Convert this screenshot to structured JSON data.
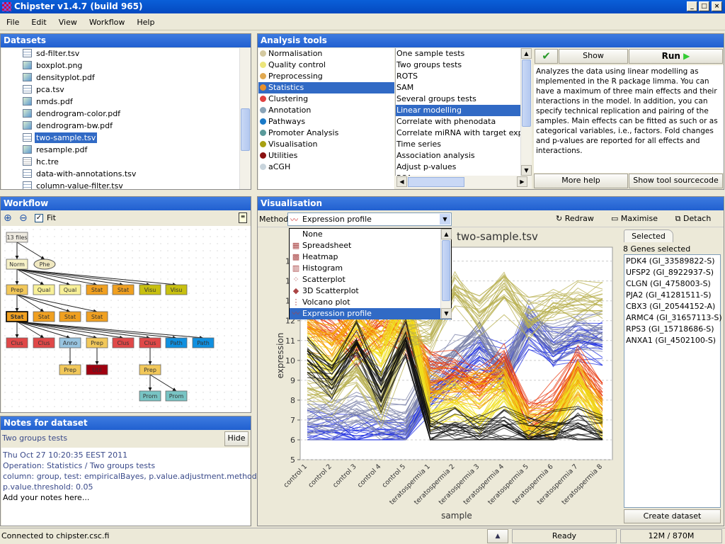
{
  "window": {
    "title": "Chipster v1.4.7 (build 965)",
    "controls": [
      "_",
      "□",
      "×"
    ]
  },
  "menu": [
    "File",
    "Edit",
    "View",
    "Workflow",
    "Help"
  ],
  "datasets": {
    "title": "Datasets",
    "items": [
      {
        "name": "sd-filter.tsv",
        "icon": "table"
      },
      {
        "name": "boxplot.png",
        "icon": "image"
      },
      {
        "name": "densityplot.pdf",
        "icon": "image"
      },
      {
        "name": "pca.tsv",
        "icon": "table"
      },
      {
        "name": "nmds.pdf",
        "icon": "image"
      },
      {
        "name": "dendrogram-color.pdf",
        "icon": "image"
      },
      {
        "name": "dendrogram-bw.pdf",
        "icon": "image"
      },
      {
        "name": "two-sample.tsv",
        "icon": "table",
        "selected": true
      },
      {
        "name": "resample.pdf",
        "icon": "image"
      },
      {
        "name": "hc.tre",
        "icon": "text"
      },
      {
        "name": "data-with-annotations.tsv",
        "icon": "table"
      },
      {
        "name": "column-value-filter.tsv",
        "icon": "table"
      }
    ]
  },
  "analysis": {
    "title": "Analysis tools",
    "categories": [
      {
        "label": "Normalisation",
        "color": "#d4c9a0"
      },
      {
        "label": "Quality control",
        "color": "#ece57a"
      },
      {
        "label": "Preprocessing",
        "color": "#e0a850"
      },
      {
        "label": "Statistics",
        "color": "#e8902c",
        "selected": true
      },
      {
        "label": "Clustering",
        "color": "#e04040"
      },
      {
        "label": "Annotation",
        "color": "#8aa4b8"
      },
      {
        "label": "Pathways",
        "color": "#1a7ac8"
      },
      {
        "label": "Promoter Analysis",
        "color": "#5a9a9a"
      },
      {
        "label": "Visualisation",
        "color": "#a8a010"
      },
      {
        "label": "Utilities",
        "color": "#8a1010"
      },
      {
        "label": "aCGH",
        "color": "#c8d4dc"
      }
    ],
    "tools": [
      "One sample tests",
      "Two groups tests",
      "ROTS",
      "SAM",
      "Several groups tests",
      "Linear modelling",
      "Correlate with phenodata",
      "Correlate miRNA with target express",
      "Time series",
      "Association analysis",
      "Adjust p-values",
      "PCA"
    ],
    "selected_tool": "Linear modelling",
    "show_parameters": "Show parameters",
    "run": "Run",
    "description": "Analyzes the data using linear modelling as implemented in the R package limma. You can have a maximum of three main effects and their interactions in the model. In addition, you can specify technical replication and pairing of the samples. Main effects can be fitted as such or as categorical variables, i.e., factors. Fold changes and p-values are reported for all effects and interactions.",
    "more_help": "More help",
    "show_source": "Show tool sourcecode"
  },
  "workflow": {
    "title": "Workflow",
    "fit_label": "Fit",
    "fit_checked": true,
    "nodes": [
      "13 files",
      "Norm",
      "Phe",
      "Prep",
      "Qual",
      "Qual",
      "Stat",
      "Stat",
      "Visu",
      "Visu",
      "Stat",
      "Stat",
      "Stat",
      "Stat",
      "Clus",
      "Clus",
      "Anno",
      "Prep",
      "Clus",
      "Clus",
      "Path",
      "Path",
      "Prep",
      "Util",
      "Prep",
      "Prom",
      "Prom"
    ]
  },
  "notes": {
    "title": "Notes for dataset",
    "tool": "Two groups tests",
    "hide": "Hide",
    "lines": [
      "Thu Oct 27 10:20:35 EEST 2011",
      "Operation: Statistics / Two groups tests",
      "column: group, test: empiricalBayes, p.value.adjustment.method: BH,",
      "p.value.threshold: 0.05"
    ],
    "user_note": "Add your notes here..."
  },
  "visualisation": {
    "title": "Visualisation",
    "method_label": "Method:",
    "method": "Expression profile",
    "redraw": "Redraw",
    "maximise": "Maximise",
    "detach": "Detach",
    "method_options": [
      "None",
      "Spreadsheet",
      "Heatmap",
      "Histogram",
      "Scatterplot",
      "3D Scatterplot",
      "Volcano plot",
      "Expression profile"
    ],
    "selected_tab": "Selected",
    "genes_count": "8 Genes selected",
    "genes": [
      "PDK4 (GI_33589822-S)",
      "UFSP2 (GI_8922937-S)",
      "CLGN (GI_4758003-S)",
      "PJA2 (GI_41281511-S)",
      "CBX3 (GI_20544152-A)",
      "ARMC4 (GI_31657113-S)",
      "RPS3 (GI_15718686-S)",
      "ANXA1 (GI_4502100-S)"
    ],
    "create_dataset": "Create dataset"
  },
  "chart_data": {
    "type": "line",
    "title": "two-sample.tsv",
    "xlabel": "sample",
    "ylabel": "expression",
    "ylim": [
      5,
      15.7
    ],
    "yticks": [
      5,
      6,
      7,
      8,
      9,
      10,
      11,
      12,
      13,
      14,
      15
    ],
    "grid": true,
    "categories": [
      "control 1",
      "control 2",
      "control 3",
      "control 4",
      "control 5",
      "teratospermia 1",
      "teratospermia 2",
      "teratospermia 3",
      "teratospermia 4",
      "teratospermia 5",
      "teratospermia 6",
      "teratospermia 7",
      "teratospermia 8"
    ],
    "series": [
      {
        "color": "#2030e0",
        "values": [
          6.4,
          6.4,
          6.2,
          6.3,
          6.3,
          8.2,
          9.2,
          10.2,
          9.5,
          11.6,
          10.4,
          11.0,
          10.8
        ]
      },
      {
        "color": "#7a80a8",
        "values": [
          7.1,
          7.0,
          7.4,
          7.0,
          6.8,
          9.2,
          10.2,
          11.2,
          9.2,
          12.0,
          10.8,
          11.2,
          11.4
        ]
      },
      {
        "color": "#e83a10",
        "values": [
          12.4,
          11.8,
          10.6,
          12.0,
          11.2,
          9.6,
          9.6,
          8.8,
          10.0,
          7.0,
          7.8,
          9.8,
          8.2
        ]
      },
      {
        "color": "#f5a000",
        "values": [
          11.6,
          10.8,
          12.2,
          11.0,
          12.6,
          8.4,
          8.6,
          8.8,
          9.0,
          6.5,
          6.8,
          9.0,
          7.2
        ]
      },
      {
        "color": "#f0e020",
        "values": [
          10.2,
          9.6,
          11.0,
          10.2,
          13.2,
          7.2,
          8.0,
          7.0,
          8.4,
          6.4,
          6.6,
          8.8,
          6.8
        ]
      },
      {
        "color": "#b8b050",
        "values": [
          8.6,
          8.2,
          9.2,
          7.6,
          11.2,
          11.2,
          13.4,
          12.2,
          13.6,
          12.0,
          12.6,
          12.8,
          12.8
        ]
      },
      {
        "color": "#101010",
        "values": [
          10.0,
          9.0,
          10.8,
          8.4,
          11.0,
          6.3,
          6.5,
          6.3,
          6.7,
          6.1,
          6.3,
          6.6,
          6.2
        ]
      }
    ]
  }
}
